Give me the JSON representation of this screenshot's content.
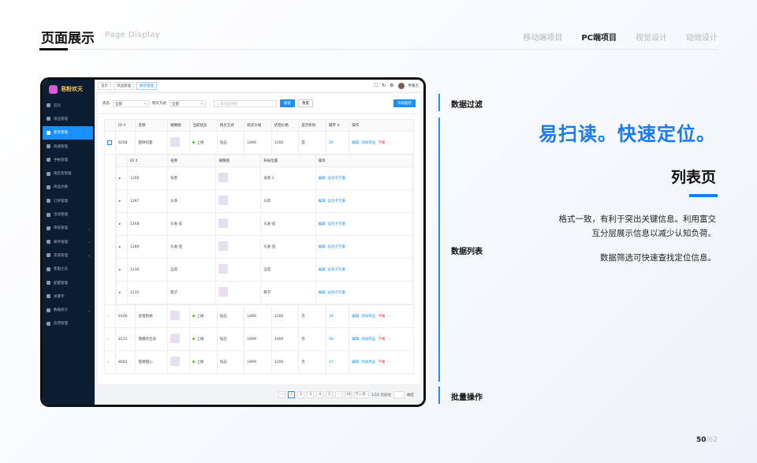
{
  "header": {
    "title": "页面展示",
    "subtitle": "Page Display",
    "tabs": [
      {
        "label": "移动端项目",
        "active": false
      },
      {
        "label": "PC端项目",
        "active": true
      },
      {
        "label": "视觉设计",
        "active": false
      },
      {
        "label": "动效设计",
        "active": false
      }
    ]
  },
  "app": {
    "logo": "皂粉欢天",
    "sidebar": [
      {
        "label": "首页"
      },
      {
        "label": "单品管理"
      },
      {
        "label": "套装管理",
        "active": true
      },
      {
        "label": "商城管理"
      },
      {
        "label": "手帐管理"
      },
      {
        "label": "限定装管理"
      },
      {
        "label": "商品兑换"
      },
      {
        "label": "订单管理"
      },
      {
        "label": "活动管理"
      },
      {
        "label": "审核管理",
        "caret": true
      },
      {
        "label": "邮件管理",
        "caret": true
      },
      {
        "label": "充值管理",
        "caret": true
      },
      {
        "label": "客服之前"
      },
      {
        "label": "配置管理"
      },
      {
        "label": "关键字"
      },
      {
        "label": "数据统计",
        "caret": true
      },
      {
        "label": "反馈管理"
      }
    ],
    "breadcrumbs": [
      "首页",
      "单品管理",
      "套装管理"
    ],
    "user": "传香方",
    "filters": {
      "status_label": "状态",
      "status_value": "全部",
      "buy_label": "购买方式",
      "buy_value": "全部",
      "search_placeholder": "请内容搜索",
      "search_btn": "搜索",
      "reset_btn": "重置",
      "add_btn": "添加套装"
    },
    "table": {
      "headers": [
        "ID ↕",
        "名称",
        "缩略图",
        "当前状态",
        "购买方式",
        "购买价格",
        "折后价格",
        "是否折扣",
        "顺序 ↕",
        "操作"
      ],
      "rows": [
        {
          "id": "8208",
          "name": "甜饼初夏",
          "status": "上线",
          "buy": "钻石",
          "price": "1899",
          "disc": "1200",
          "is_disc": "是",
          "order": "20"
        },
        {
          "id": "8106",
          "name": "星夜和林",
          "status": "上线",
          "buy": "钻石",
          "price": "1899",
          "disc": "1200",
          "is_disc": "否",
          "order": "19"
        },
        {
          "id": "8111",
          "name": "落樱的告白",
          "status": "上线",
          "buy": "钻石",
          "price": "1899",
          "disc": "1000",
          "is_disc": "否",
          "order": "18"
        },
        {
          "id": "8002",
          "name": "甜果甜心",
          "status": "上线",
          "buy": "钻石",
          "price": "1899",
          "disc": "1200",
          "is_disc": "否",
          "order": "17"
        }
      ],
      "ops": [
        "编辑",
        "添加单品",
        "下线",
        "···"
      ],
      "sub_headers": [
        "ID ↕",
        "名称",
        "缩略图",
        "布局位置",
        "操作"
      ],
      "sub_rows": [
        {
          "id": "1266",
          "name": "背景",
          "pos": "背景-1"
        },
        {
          "id": "1267",
          "name": "头饰",
          "pos": "头饰"
        },
        {
          "id": "1268",
          "name": "头发-前",
          "pos": "头发-前"
        },
        {
          "id": "1269",
          "name": "头发-后",
          "pos": "头发-后"
        },
        {
          "id": "1230",
          "name": "五官",
          "pos": "五官"
        },
        {
          "id": "1231",
          "name": "鞋子",
          "pos": "鞋子"
        }
      ],
      "sub_ops": [
        "编辑",
        "设为子元素"
      ]
    },
    "pager": {
      "pages": [
        "‹",
        "1",
        "2",
        "3",
        "4",
        "5",
        "···",
        "10",
        "下一页 ›"
      ],
      "info": "1/10 页前往",
      "confirm": "确定"
    }
  },
  "labels": {
    "filter": "数据过滤",
    "list": "数据列表",
    "batch": "批量操作"
  },
  "slogan": "易扫读。快速定位。",
  "list_title": "列表页",
  "desc": [
    "格式一致，有利于突出关键信息。利用富交",
    "互分层展示信息以减少认知负荷。",
    "数据筛选可快速查找定位信息。"
  ],
  "page": {
    "current": "50",
    "total": "/62"
  }
}
